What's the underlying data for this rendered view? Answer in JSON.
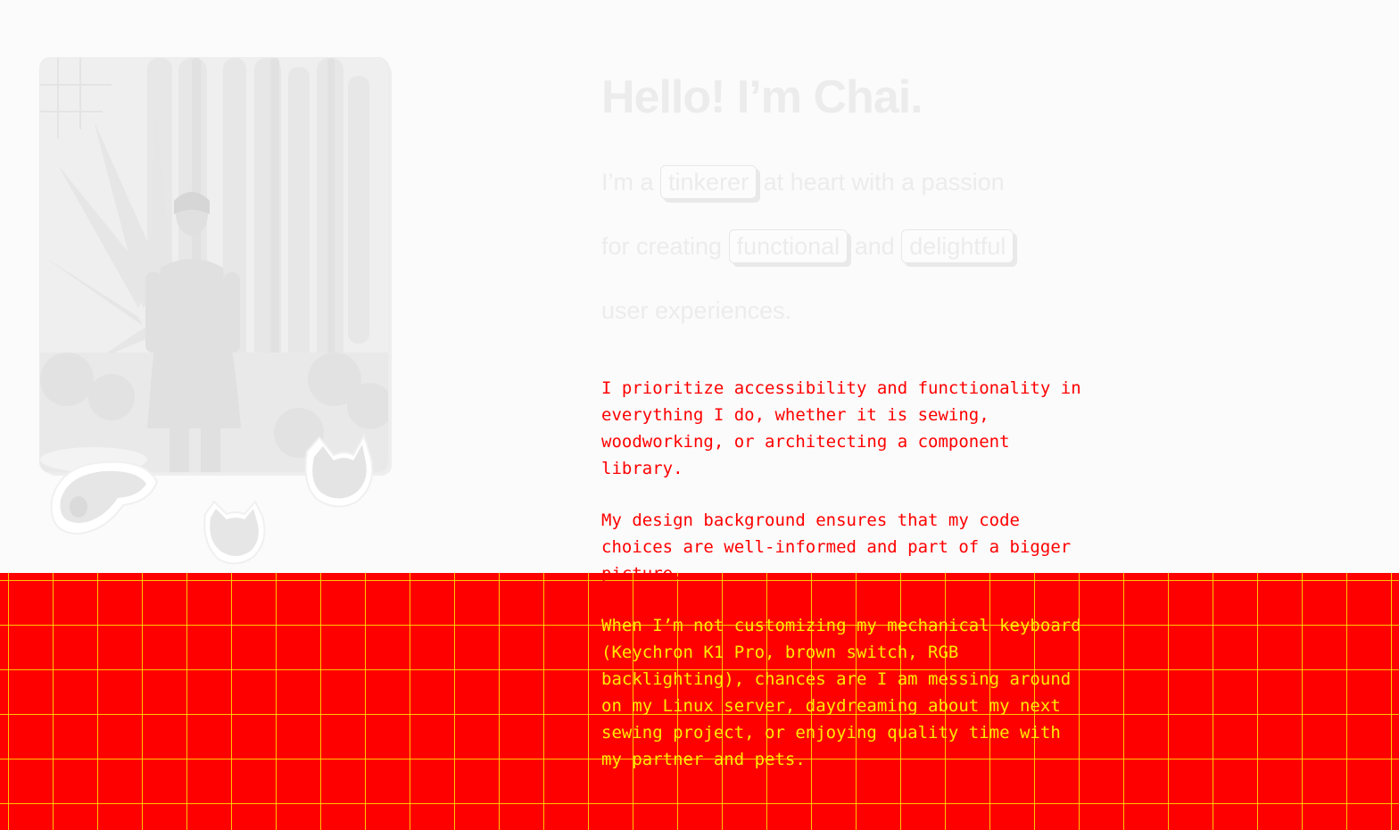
{
  "profile": {
    "photo_alt": "Chai standing in front of cacti",
    "pet_stickers": [
      "dog-sticker",
      "cat-sticker-right",
      "cat-sticker-bottom"
    ]
  },
  "hero": {
    "title": "Hello! I’m Chai."
  },
  "tagline": {
    "prefix": "I’m a",
    "pill_1": "tinkerer",
    "mid_1": "at heart with a passion",
    "lead_2": "for creating",
    "pill_2": "functional",
    "mid_2": "and",
    "pill_3": "delightful",
    "tail": "user experiences."
  },
  "about": {
    "p1": "I prioritize accessibility and functionality in everything I do, whether it is sewing, woodworking, or architecting a component library.",
    "p2": "My design background ensures that my code choices are well-informed and part of a bigger picture.",
    "p3": "When I’m not customizing my mechanical keyboard (Keychron K1 Pro, brown switch, RGB backlighting), chances are I am messing around on my Linux server, daydreaming about my next sewing project, or enjoying quality time with my partner and pets."
  },
  "colors": {
    "background": "#fbfbfb",
    "grid_band": "#ff0000",
    "grid_lines": "#ffe600",
    "body_text": "#ff0000",
    "heading_text": "#ececec"
  }
}
